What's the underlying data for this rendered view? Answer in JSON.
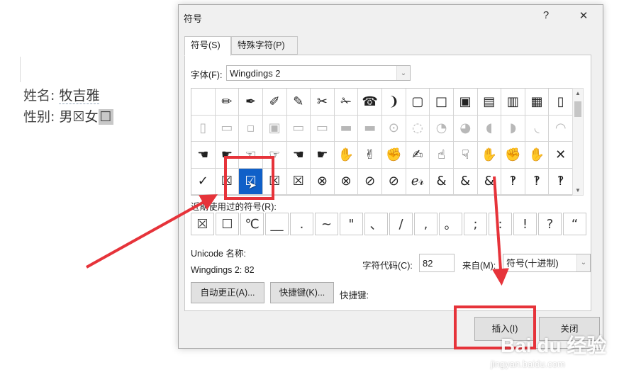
{
  "document": {
    "name_label": "姓名:",
    "name_value": "牧吉雅",
    "gender_label": "性别:",
    "gender_value": "男☒女",
    "selected_char": "☐"
  },
  "dialog": {
    "title": "符号",
    "help": "?",
    "close": "✕",
    "tabs": [
      "符号(S)",
      "特殊字符(P)"
    ],
    "font_label": "字体(F):",
    "font_value": "Wingdings 2",
    "symbols": [
      [
        "",
        "✏",
        "✒",
        "✐",
        "✎",
        "✂",
        "✁",
        "☎",
        "❩",
        "▢",
        "□",
        "▣",
        "▤",
        "▥",
        "▦",
        "▯"
      ],
      [
        "▯",
        "▭",
        "▫",
        "▣",
        "▭",
        "▭",
        "▬",
        "▬",
        "⊙",
        "◌",
        "◔",
        "◕",
        "◖",
        "◗",
        "◟",
        "◠"
      ],
      [
        "☚",
        "☛",
        "☜",
        "☞",
        "☚",
        "☛",
        "✋",
        "✌",
        "✊",
        "✍",
        "☝",
        "☟",
        "✋",
        "✊",
        "✋",
        "✕"
      ],
      [
        "✓",
        "☒",
        "☑",
        "☒",
        "☒",
        "⊗",
        "⊗",
        "⊘",
        "⊘",
        "ℯ𝓇",
        "&",
        "&",
        "&",
        "‽",
        "‽",
        "‽"
      ]
    ],
    "recent_label": "近期使用过的符号(R):",
    "recent": [
      "☒",
      "☐",
      "℃",
      "__",
      ".",
      "~",
      "\"",
      "、",
      "/",
      ",",
      "。",
      ";",
      ":",
      "!",
      "?",
      "“"
    ],
    "unicode_name_label": "Unicode 名称:",
    "unicode_value": "Wingdings 2: 82",
    "char_code_label": "字符代码(C):",
    "char_code_value": "82",
    "from_label": "来自(M):",
    "from_value": "符号(十进制)",
    "autocorrect_button": "自动更正(A)...",
    "shortcut_key_button": "快捷键(K)...",
    "shortcut_key_label": "快捷键:",
    "insert_button": "插入(I)",
    "close_button": "关闭"
  },
  "watermark": {
    "brand": "Bai du 经验",
    "url": "jingyan.baidu.com"
  },
  "colors": {
    "annotation": "#e6333a",
    "selection": "#1060c8"
  }
}
